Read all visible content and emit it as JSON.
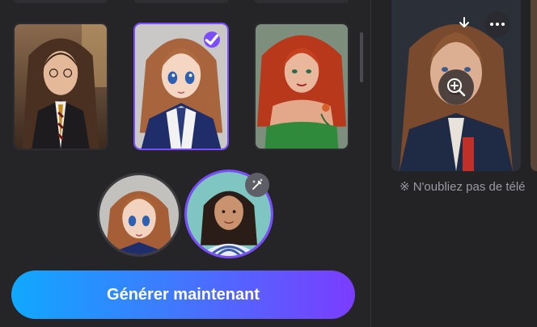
{
  "generator": {
    "style_cards": [
      {
        "name": "realistic-student",
        "selected": false
      },
      {
        "name": "anime-girl",
        "selected": true
      },
      {
        "name": "red-hair-fantasy",
        "selected": false
      }
    ],
    "preview_avatars": [
      "anime-result",
      "user-photo"
    ],
    "generate_label": "Générer maintenant"
  },
  "results": {
    "reminder": "※ N'oubliez pas de télé"
  },
  "colors": {
    "accent": "#7b4dff",
    "button_gradient_start": "#10a8ff",
    "button_gradient_end": "#7b3cff",
    "panel_bg": "#252528"
  }
}
